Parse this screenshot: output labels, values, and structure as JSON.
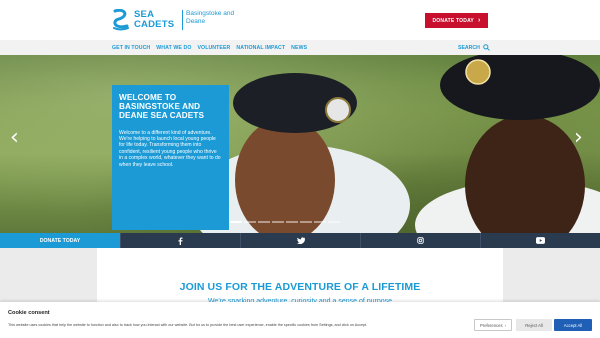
{
  "header": {
    "logo_line1": "SEA",
    "logo_line2": "CADETS",
    "unit_name_line1": "Basingstoke and",
    "unit_name_line2": "Deane",
    "donate_label": "DONATE TODAY",
    "donate_chevron": "›"
  },
  "nav": {
    "items": [
      {
        "label": "GET IN TOUCH"
      },
      {
        "label": "WHAT WE DO"
      },
      {
        "label": "VOLUNTEER"
      },
      {
        "label": "NATIONAL IMPACT"
      },
      {
        "label": "NEWS"
      }
    ],
    "search_label": "SEARCH"
  },
  "hero": {
    "title": "WELCOME TO BASINGSTOKE AND DEANE SEA CADETS",
    "text": "Welcome to a different kind of adventure. We're helping to launch local young people for life today. Transforming them into confident, resilient young people who thrive in a complex world, whatever they want to do when they leave school.",
    "arrow_left": "‹",
    "arrow_right": "›",
    "slide_count": 8,
    "active_slide": 1
  },
  "social": {
    "donate_label": "DONATE TODAY",
    "icons": [
      "facebook-icon",
      "twitter-icon",
      "instagram-icon",
      "youtube-icon"
    ]
  },
  "main": {
    "title": "JOIN US FOR THE ADVENTURE OF A LIFETIME",
    "subtitle": "We're sparking adventure, curiosity and a sense of purpose"
  },
  "cookie": {
    "title": "Cookie consent",
    "text": "This website uses cookies that help the website to function and also to track how you interact with our website. But for us to provide the best user experience, enable the specific cookies from Settings, and click on Accept.",
    "preferences_label": "Preferences",
    "reject_label": "Reject All",
    "accept_label": "Accept All"
  },
  "colors": {
    "brand_blue": "#1b9ad6",
    "donate_red": "#c8102e",
    "social_navy": "#2a3a4f",
    "accept_blue": "#1f5fb5"
  }
}
